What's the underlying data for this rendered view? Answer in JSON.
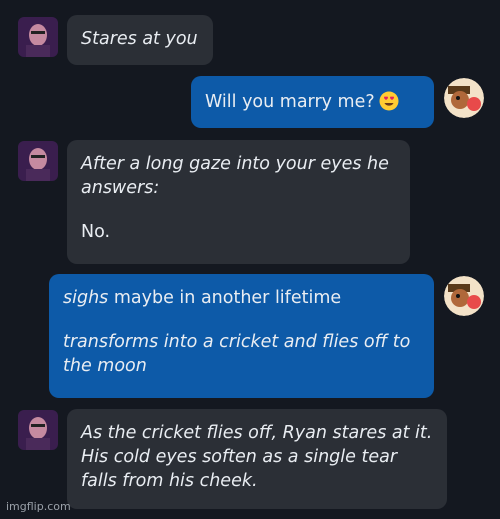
{
  "messages": [
    {
      "from": "ryan",
      "parts": {
        "action": "Stares at you"
      }
    },
    {
      "from": "user",
      "parts": {
        "text": "Will you marry me?",
        "emoji": "heart-eyes-emoji"
      }
    },
    {
      "from": "ryan",
      "parts": {
        "action": "After a long gaze into your eyes he answers:",
        "reply": "No."
      }
    },
    {
      "from": "user",
      "parts": {
        "action1": "sighs",
        "text1": " maybe in another lifetime",
        "action2": "transforms into a cricket and flies off to the moon"
      }
    },
    {
      "from": "ryan",
      "parts": {
        "action": "As the cricket flies off, Ryan stares at it. His cold eyes soften as a single tear falls from his cheek."
      }
    }
  ],
  "watermark": "imgflip.com",
  "colors": {
    "background": "#141820",
    "incoming_bubble": "#2b2f36",
    "outgoing_bubble": "#0d5aa8",
    "text": "#e9edf2"
  }
}
